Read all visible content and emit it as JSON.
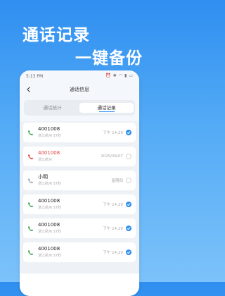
{
  "hero": {
    "line1": "通话记录",
    "line2": "一键备份"
  },
  "status_bar": {
    "time": "5:13 PM"
  },
  "nav": {
    "title": "通话信息"
  },
  "tabs": [
    {
      "label": "通话统计",
      "active": false
    },
    {
      "label": "通话记录",
      "active": true
    }
  ],
  "records": [
    {
      "name": "4001008",
      "location": "浙江杭州 57秒",
      "time": "下午 14:20",
      "type": "incoming",
      "checked": true
    },
    {
      "name": "4001008",
      "location": "浙江杭州",
      "time": "2025/06/07",
      "type": "missed",
      "checked": false
    },
    {
      "name": "小明",
      "location": "浙江杭州 57秒",
      "time": "星期四",
      "type": "outgoing",
      "checked": false
    },
    {
      "name": "4001008",
      "location": "浙江杭州 57秒",
      "time": "下午 14:20",
      "type": "incoming",
      "checked": true
    },
    {
      "name": "4001008",
      "location": "浙江杭州 57秒",
      "time": "下午 14:20",
      "type": "incoming",
      "checked": true
    },
    {
      "name": "4001008",
      "location": "浙江杭州 57秒",
      "time": "下午 14:20",
      "type": "incoming",
      "checked": true
    }
  ],
  "colors": {
    "accent": "#2f8ff0",
    "incoming": "#3aa655",
    "missed": "#e04444",
    "outgoing": "#9aa3ad"
  }
}
